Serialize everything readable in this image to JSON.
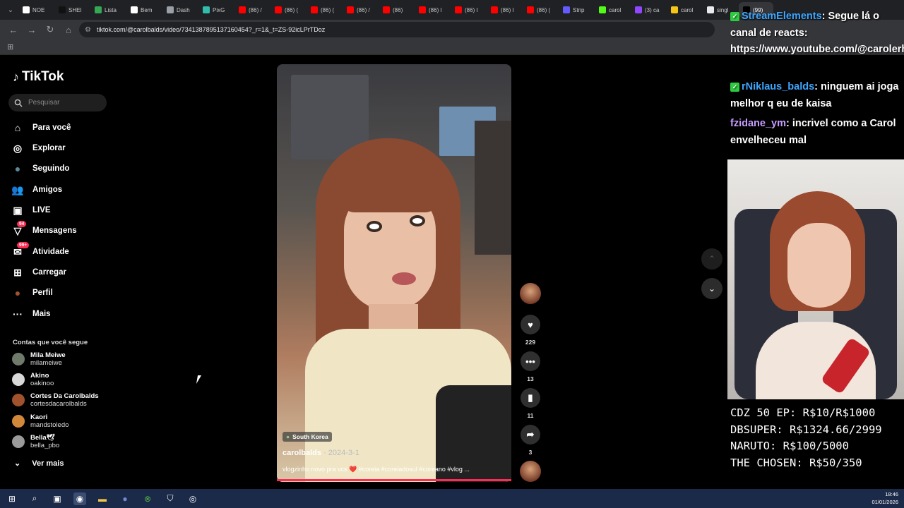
{
  "browser": {
    "tabs": [
      {
        "label": "NOE",
        "icon": "notion-icon",
        "color": "#ffffff"
      },
      {
        "label": "SHEI",
        "icon": "shein-icon",
        "color": "#111111"
      },
      {
        "label": "Lista",
        "icon": "sheet-icon",
        "color": "#34a853"
      },
      {
        "label": "Bem",
        "icon": "notion-icon",
        "color": "#ffffff"
      },
      {
        "label": "Dash",
        "icon": "globe-icon",
        "color": "#9aa0a6"
      },
      {
        "label": "PixG",
        "icon": "pix-icon",
        "color": "#32bcad"
      },
      {
        "label": "(86) /",
        "icon": "youtube-icon",
        "color": "#ff0000"
      },
      {
        "label": "(86) (",
        "icon": "youtube-icon",
        "color": "#ff0000"
      },
      {
        "label": "(86) (",
        "icon": "youtube-icon",
        "color": "#ff0000"
      },
      {
        "label": "(86) /",
        "icon": "youtube-icon",
        "color": "#ff0000"
      },
      {
        "label": "(86) ",
        "icon": "youtube-icon",
        "color": "#ff0000"
      },
      {
        "label": "(86) I",
        "icon": "youtube-icon",
        "color": "#ff0000"
      },
      {
        "label": "(86) I",
        "icon": "youtube-icon",
        "color": "#ff0000"
      },
      {
        "label": "(86) I",
        "icon": "youtube-icon",
        "color": "#ff0000"
      },
      {
        "label": "(86) (",
        "icon": "youtube-icon",
        "color": "#ff0000"
      },
      {
        "label": "Strip",
        "icon": "stripe-icon",
        "color": "#635bff"
      },
      {
        "label": "carol",
        "icon": "kick-icon",
        "color": "#53fc18"
      },
      {
        "label": "(3) ca",
        "icon": "twitch-icon",
        "color": "#9146ff"
      },
      {
        "label": "carol",
        "icon": "crown-icon",
        "color": "#f5c518"
      },
      {
        "label": "singl",
        "icon": "google-icon",
        "color": "#e8eaed"
      },
      {
        "label": "(99)",
        "icon": "tiktok-icon",
        "color": "#000000"
      }
    ],
    "url": "tiktok.com/@carolbalds/video/7341387895137160454?_r=1&_t=ZS-92icLPrTDoz"
  },
  "tiktok": {
    "logo_text": "TikTok",
    "search_placeholder": "Pesquisar",
    "nav": [
      {
        "label": "Para você",
        "icon": "home-icon"
      },
      {
        "label": "Explorar",
        "icon": "compass-icon"
      },
      {
        "label": "Seguindo",
        "icon": "following-avatar-icon"
      },
      {
        "label": "Amigos",
        "icon": "friends-icon"
      },
      {
        "label": "LIVE",
        "icon": "live-icon"
      },
      {
        "label": "Mensagens",
        "icon": "messages-icon",
        "badge": "94"
      },
      {
        "label": "Atividade",
        "icon": "activity-icon",
        "badge": "99+"
      },
      {
        "label": "Carregar",
        "icon": "upload-icon"
      },
      {
        "label": "Perfil",
        "icon": "profile-avatar-icon"
      },
      {
        "label": "Mais",
        "icon": "more-dots-icon"
      }
    ],
    "following_title": "Contas que você segue",
    "following": [
      {
        "name": "Mila Meiwe",
        "handle": "milameiwe",
        "color": "#6f7a6a"
      },
      {
        "name": "Akino",
        "handle": "oakinoo",
        "color": "#d8d8d8"
      },
      {
        "name": "Cortes Da Carolbalds",
        "handle": "cortesdacarolbalds",
        "color": "#a0522d"
      },
      {
        "name": "Kaori",
        "handle": "mandstoledo",
        "color": "#d2883a"
      },
      {
        "name": "Bella🕊",
        "handle": "bella_pbo",
        "color": "#9a9a9a"
      }
    ],
    "see_more": "Ver mais",
    "video": {
      "location": "South Korea",
      "author": "carolbalds",
      "date": " · 2024-3-1",
      "caption": "vlogzinho novo pra vcs ❤️ #coreia #coreiadosul #coreano #vlog ...",
      "progress": 1.0
    },
    "actions": {
      "likes": "229",
      "comments": "13",
      "saves": "11",
      "shares": "3"
    }
  },
  "stream_overlay": {
    "chat": [
      {
        "user": "StreamElements",
        "text": ": Segue lá o canal de reacts: https://www.youtube.com/@carolerhay"
      },
      {
        "user": "rNiklaus_balds",
        "text": ": ninguem ai joga melhor q eu de kaisa"
      },
      {
        "user": "fzidane_ym",
        "text": ": incrivel como a Carol envelheceu mal"
      }
    ],
    "donations": [
      "CDZ 50 EP: R$10/R$1000",
      "DBSUPER: R$1324.66/2999",
      "NARUTO: R$100/5000",
      "THE CHOSEN: R$50/350"
    ]
  },
  "taskbar": {
    "time": "18:46",
    "date": "01/01/2026"
  }
}
